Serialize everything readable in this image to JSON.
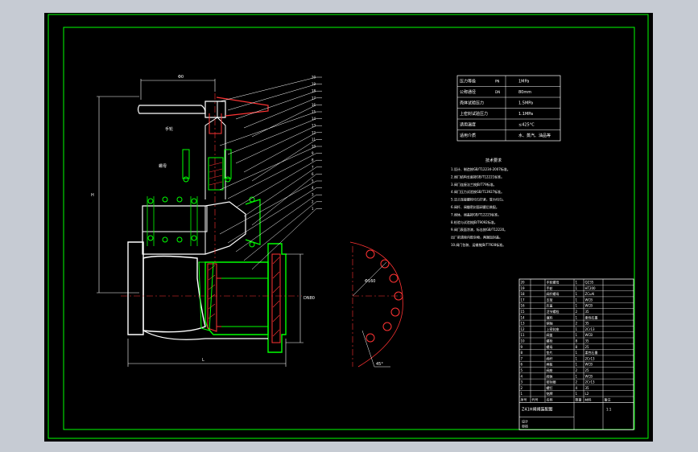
{
  "drawing": {
    "title": "Z41H闸阀装配图",
    "view_bg": "#000000",
    "frame_color": "#00ff00",
    "outline_color": "#ffffff",
    "accent_color": "#ff3333",
    "dim_color": "#ffffff",
    "leader_color": "#ffffff"
  },
  "tech_table": {
    "rows": [
      {
        "label": "压力等级",
        "code": "PN",
        "value": "1MPa"
      },
      {
        "label": "公称通径",
        "code": "DN",
        "value": "80mm"
      },
      {
        "label": "壳体试验压力",
        "code": "",
        "value": "1.5MPa"
      },
      {
        "label": "上密封试验压力",
        "code": "",
        "value": "1.1MPa"
      },
      {
        "label": "适用温度",
        "code": "",
        "value": "≤425°C"
      },
      {
        "label": "适用介质",
        "code": "",
        "value": "水、蒸汽、油品等"
      }
    ]
  },
  "tech_req": {
    "heading": "技术要求",
    "items": [
      "1.设计、制造按GB/T12234-2007标准。",
      "2.阀门结构长度按GB/T12221标准。",
      "3.阀门连接法兰按JB/T79标准。",
      "4.阀门压力试验按GB/T13927标准。",
      "5.法兰连接螺栓均匀拧紧，受力均匀。",
      "6.阀杆、阀瓣密封面研磨后装配。",
      "7.阀体、阀盖按GB/T12225标准。",
      "8.检验与试验按JB/T9092标准。",
      "9.阀门表面涂漆，标志按GB/T12220。",
      "  出厂前清除内腔杂物，两端加封盖。",
      "10.阀门包装、运输按JB/T7928标准。"
    ]
  },
  "balloons": [
    "20",
    "19",
    "18",
    "17",
    "16",
    "15",
    "14",
    "13",
    "12",
    "11",
    "10",
    "9",
    "8",
    "7",
    "6",
    "5",
    "4",
    "3",
    "2",
    "1"
  ],
  "dim_labels": {
    "top_width": "Φ0",
    "height": "H",
    "length": "L",
    "bore": "DN80",
    "pcd": "Φ160",
    "angle": "45°",
    "label_a": "手轮",
    "label_b": "螺母"
  },
  "bom": {
    "header": [
      "序号",
      "代号",
      "名称",
      "数量",
      "材料",
      "备注"
    ],
    "rows": [
      {
        "no": "20",
        "code": "",
        "name": "手轮螺母",
        "qty": "1",
        "mat": "Q235"
      },
      {
        "no": "19",
        "code": "",
        "name": "手轮",
        "qty": "1",
        "mat": "HT200"
      },
      {
        "no": "18",
        "code": "",
        "name": "阀杆螺母",
        "qty": "1",
        "mat": "ZCuAl"
      },
      {
        "no": "17",
        "code": "",
        "name": "支架",
        "qty": "1",
        "mat": "WCB"
      },
      {
        "no": "16",
        "code": "",
        "name": "压盖",
        "qty": "1",
        "mat": "WCB"
      },
      {
        "no": "15",
        "code": "",
        "name": "活节螺栓",
        "qty": "2",
        "mat": "35"
      },
      {
        "no": "14",
        "code": "",
        "name": "填料",
        "qty": "1",
        "mat": "柔性石墨"
      },
      {
        "no": "13",
        "code": "",
        "name": "销轴",
        "qty": "2",
        "mat": "35"
      },
      {
        "no": "12",
        "code": "",
        "name": "上密封座",
        "qty": "1",
        "mat": "2Cr13"
      },
      {
        "no": "11",
        "code": "",
        "name": "阀盖",
        "qty": "1",
        "mat": "WCB"
      },
      {
        "no": "10",
        "code": "",
        "name": "螺栓",
        "qty": "8",
        "mat": "35"
      },
      {
        "no": "9",
        "code": "",
        "name": "螺母",
        "qty": "8",
        "mat": "25"
      },
      {
        "no": "8",
        "code": "",
        "name": "垫片",
        "qty": "1",
        "mat": "柔性石墨"
      },
      {
        "no": "7",
        "code": "",
        "name": "阀杆",
        "qty": "1",
        "mat": "2Cr13"
      },
      {
        "no": "6",
        "code": "",
        "name": "闸板",
        "qty": "1",
        "mat": "WCB"
      },
      {
        "no": "5",
        "code": "",
        "name": "阀座",
        "qty": "2",
        "mat": "25"
      },
      {
        "no": "4",
        "code": "",
        "name": "阀体",
        "qty": "1",
        "mat": "WCB"
      },
      {
        "no": "3",
        "code": "",
        "name": "密封圈",
        "qty": "2",
        "mat": "2Cr13"
      },
      {
        "no": "2",
        "code": "",
        "name": "螺钉",
        "qty": "4",
        "mat": "35"
      },
      {
        "no": "1",
        "code": "",
        "name": "铭牌",
        "qty": "1",
        "mat": "L2"
      }
    ],
    "title_block": {
      "name": "Z41H闸阀装配图",
      "scale": "1:1",
      "designer": "设计",
      "checker": "审核"
    }
  }
}
